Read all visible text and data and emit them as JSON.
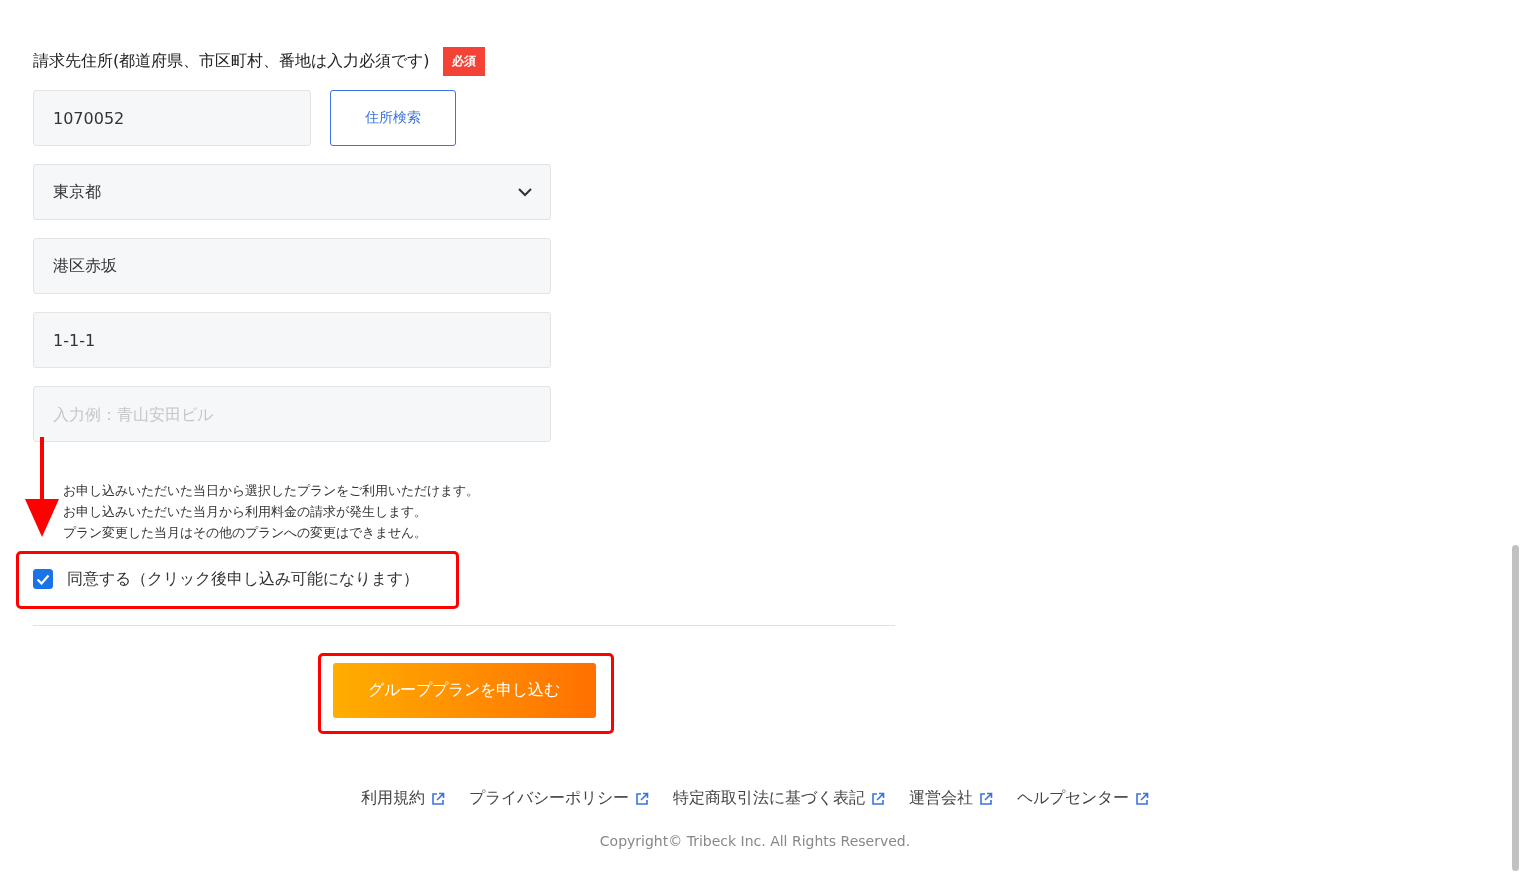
{
  "address": {
    "label": "請求先住所(都道府県、市区町村、番地は入力必須です)",
    "required_badge": "必須",
    "postal_code": {
      "value": "1070052"
    },
    "search_button": "住所検索",
    "prefecture": {
      "value": "東京都"
    },
    "city": {
      "value": "港区赤坂"
    },
    "street": {
      "value": "1-1-1"
    },
    "building": {
      "placeholder": "入力例：青山安田ビル"
    }
  },
  "notes": [
    "お申し込みいただいた当日から選択したプランをご利用いただけます。",
    "お申し込みいただいた当月から利用料金の請求が発生します。",
    "プラン変更した当月はその他のプランへの変更はできません。"
  ],
  "agreement": {
    "label": "同意する（クリック後申し込み可能になります）",
    "checked": true
  },
  "submit_button": "グループプランを申し込む",
  "footer": {
    "links": [
      "利用規約",
      "プライバシーポリシー",
      "特定商取引法に基づく表記",
      "運営会社",
      "ヘルプセンター"
    ],
    "copyright": "Copyright© Tribeck Inc. All Rights Reserved."
  }
}
